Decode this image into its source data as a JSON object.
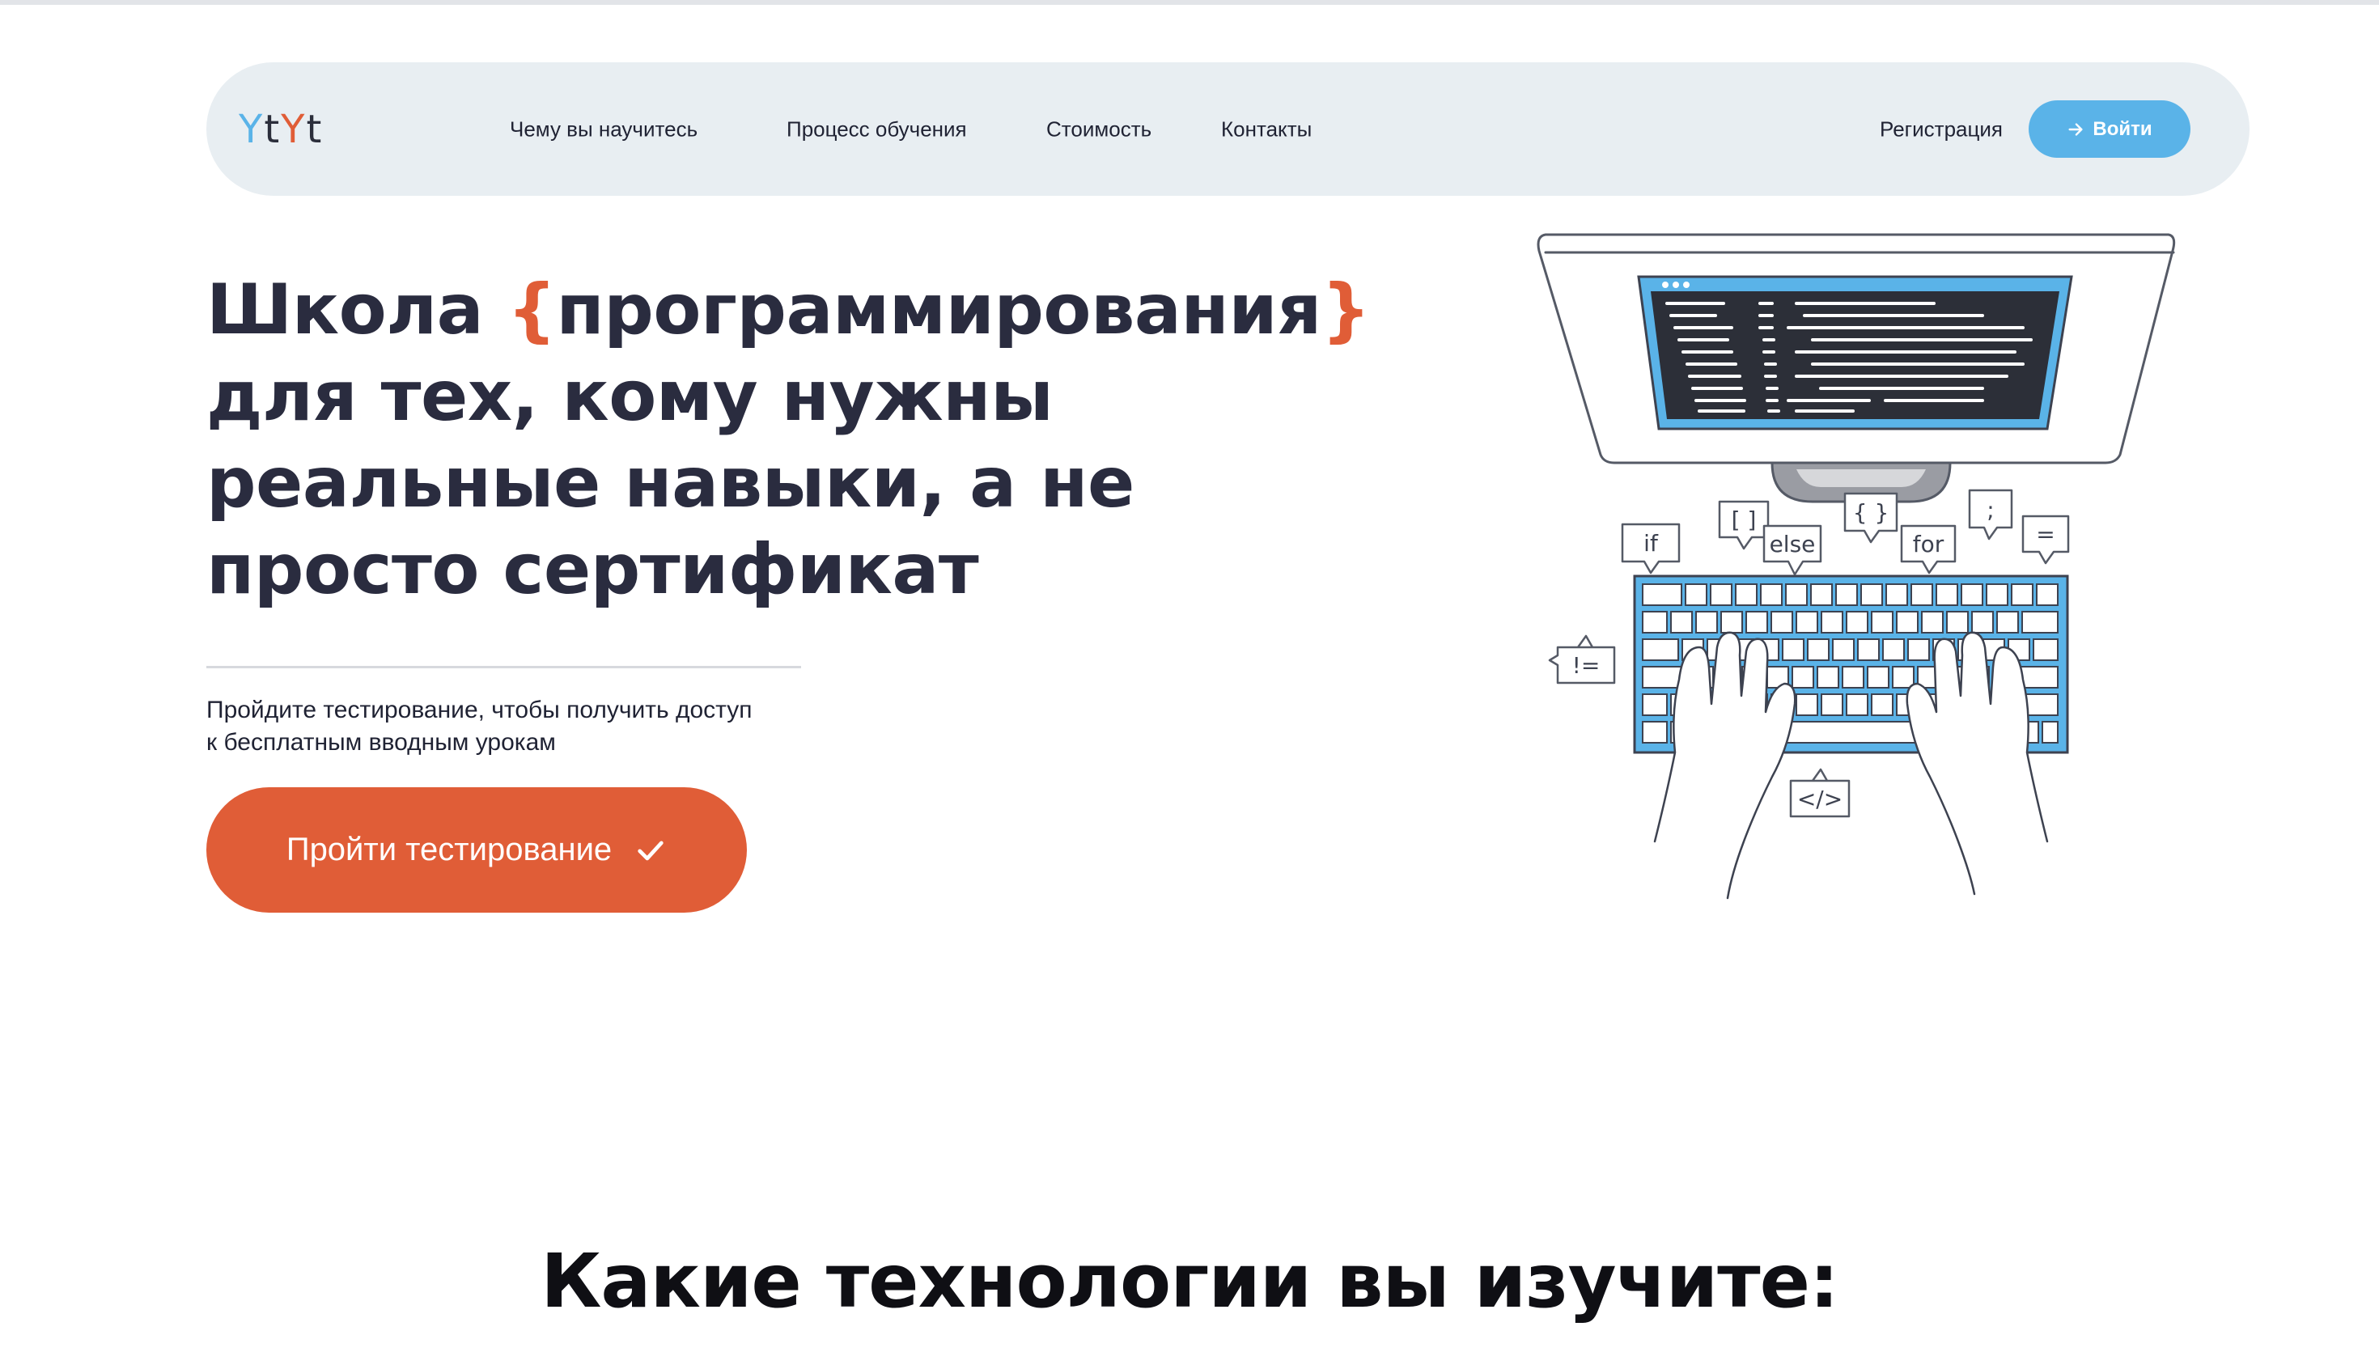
{
  "header": {
    "logo": [
      "Y",
      "t",
      "Y",
      "t"
    ],
    "nav": [
      {
        "label": "Чему вы научитесь"
      },
      {
        "label": "Процесс обучения"
      },
      {
        "label": "Стоимость"
      },
      {
        "label": "Контакты"
      }
    ],
    "register_label": "Регистрация",
    "login_label": "Войти",
    "login_icon": "arrow-right-icon"
  },
  "hero": {
    "title_lines": [
      {
        "before": "Школа ",
        "brace_open": "{",
        "word": "программирования",
        "brace_close": "}"
      },
      {
        "text": "для тех, кому нужны"
      },
      {
        "text": "реальные навыки, а не"
      },
      {
        "text": "просто сертификат"
      }
    ],
    "subtitle_lines": [
      "Пройдите тестирование, чтобы получить доступ",
      "к бесплатным вводным урокам"
    ],
    "cta_label": "Пройти тестирование",
    "cta_icon": "checkmark-icon"
  },
  "illustration": {
    "bubbles": [
      "if",
      "[ ]",
      "else",
      "{ }",
      "for",
      ";",
      "=",
      "!=",
      "</>"
    ]
  },
  "section": {
    "title": "Какие технологии вы изучите:"
  },
  "colors": {
    "accent_orange": "#e05d37",
    "accent_blue": "#5ab3e8",
    "header_bg": "#e8eef2",
    "text_dark": "#2a2c3f"
  }
}
